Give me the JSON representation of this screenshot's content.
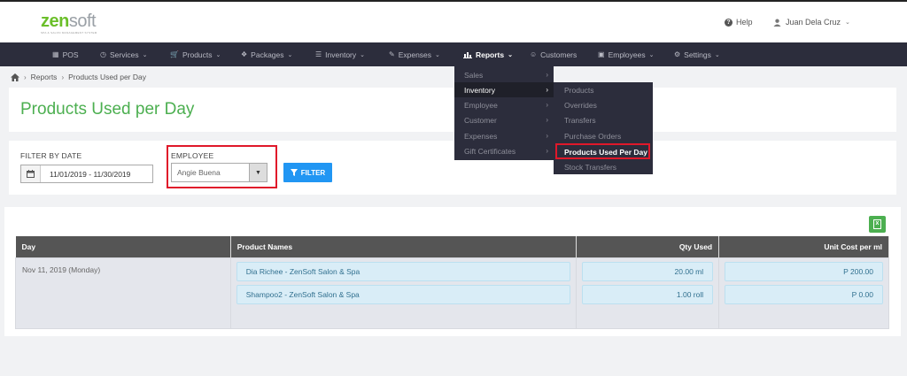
{
  "brand": {
    "name_part1": "zen",
    "name_part2": "soft",
    "tagline": "SPA & SALON MANAGEMENT SYSTEM",
    "accent": "#6bbf2a"
  },
  "header": {
    "help_label": "Help",
    "user_name": "Juan Dela Cruz"
  },
  "nav": {
    "items": [
      {
        "label": "POS",
        "icon": "grid-icon"
      },
      {
        "label": "Services",
        "icon": "clock-icon"
      },
      {
        "label": "Products",
        "icon": "cart-icon"
      },
      {
        "label": "Packages",
        "icon": "tags-icon"
      },
      {
        "label": "Inventory",
        "icon": "list-icon"
      },
      {
        "label": "Expenses",
        "icon": "edit-icon"
      },
      {
        "label": "Reports",
        "icon": "bar-chart-icon"
      },
      {
        "label": "Customers",
        "icon": "users-icon"
      },
      {
        "label": "Employees",
        "icon": "briefcase-icon"
      },
      {
        "label": "Settings",
        "icon": "cog-icon"
      }
    ],
    "active": "Reports"
  },
  "breadcrumb": {
    "items": [
      "Reports",
      "Products Used per Day"
    ]
  },
  "page": {
    "title": "Products Used per Day"
  },
  "filters": {
    "date_label": "FILTER BY DATE",
    "date_range": "11/01/2019 - 11/30/2019",
    "employee_label": "EMPLOYEE",
    "employee_value": "Angie Buena",
    "filter_button": "FILTER"
  },
  "table": {
    "headers": [
      "Day",
      "Product Names",
      "Qty Used",
      "Unit Cost per ml"
    ],
    "rows": [
      {
        "day": "Nov 11, 2019 (Monday)",
        "products": [
          {
            "name": "Dia Richee - ZenSoft Salon & Spa",
            "qty": "20.00 ml",
            "cost": "P 200.00"
          },
          {
            "name": "Shampoo2 - ZenSoft Salon & Spa",
            "qty": "1.00 roll",
            "cost": "P 0.00"
          }
        ]
      }
    ]
  },
  "reports_menu": {
    "items": [
      "Sales",
      "Inventory",
      "Employee",
      "Customer",
      "Expenses",
      "Gift Certificates"
    ],
    "active": "Inventory"
  },
  "inventory_submenu": {
    "items": [
      "Products",
      "Overrides",
      "Transfers",
      "Purchase Orders",
      "Products Used Per Day",
      "Stock Transfers"
    ],
    "highlighted": "Products Used Per Day"
  }
}
